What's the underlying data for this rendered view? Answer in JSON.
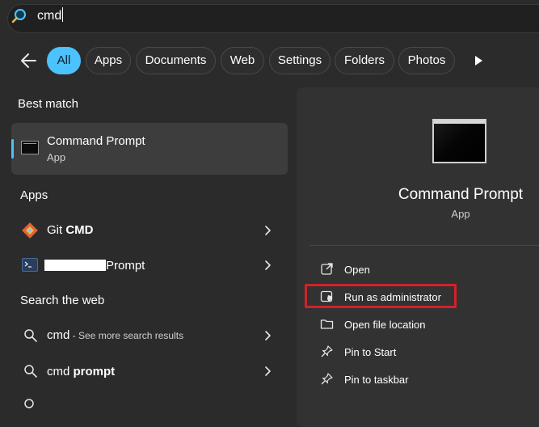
{
  "search": {
    "value": "cmd"
  },
  "filters": {
    "chips": [
      "All",
      "Apps",
      "Documents",
      "Web",
      "Settings",
      "Folders",
      "Photos"
    ],
    "active": "All"
  },
  "best_match": {
    "heading": "Best match",
    "title": "Command Prompt",
    "subtitle": "App"
  },
  "apps": {
    "heading": "Apps",
    "items": [
      {
        "prefix": "Git ",
        "bold": "CMD"
      },
      {
        "prefix": "",
        "bold": "",
        "suffix": "Prompt"
      }
    ]
  },
  "web": {
    "heading": "Search the web",
    "items": [
      {
        "query": "cmd",
        "hint": " - See more search results"
      },
      {
        "query": "cmd ",
        "bold": "prompt"
      }
    ]
  },
  "detail": {
    "title": "Command Prompt",
    "subtitle": "App",
    "actions": [
      "Open",
      "Run as administrator",
      "Open file location",
      "Pin to Start",
      "Pin to taskbar"
    ]
  },
  "colors": {
    "accent": "#4cc2ff",
    "highlight": "#d4202a",
    "background": "#2b2b2b",
    "pane": "#323232"
  }
}
